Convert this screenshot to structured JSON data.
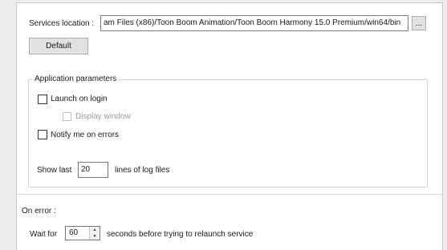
{
  "services": {
    "label": "Services location :",
    "path": "am Files (x86)/Toon Boom Animation/Toon Boom Harmony 15.0 Premium/win64/bin",
    "browse_label": "...",
    "default_label": "Default"
  },
  "app_params": {
    "title": "Application parameters",
    "launch_on_login": {
      "label": "Launch on login",
      "checked": false
    },
    "display_window": {
      "label": "Display window",
      "checked": false,
      "disabled": true
    },
    "notify_on_errors": {
      "label": "Notify me on errors",
      "checked": false
    },
    "show_last_label": "Show last",
    "show_last_value": "20",
    "lines_suffix": "lines of log files"
  },
  "on_error": {
    "label": "On error :",
    "wait_for_label": "Wait for",
    "wait_value": "60",
    "suffix": "seconds before trying to relaunch service"
  }
}
